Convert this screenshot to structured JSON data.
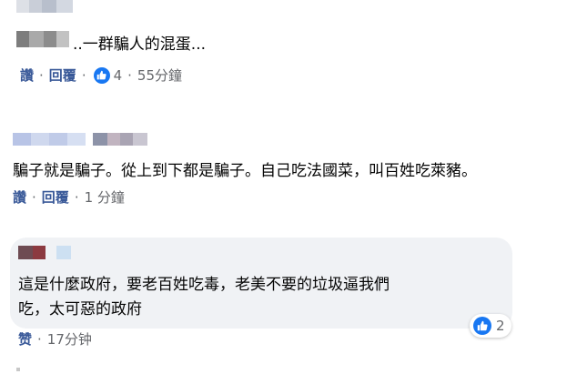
{
  "comments": [
    {
      "text": "..一群騙人的混蛋...",
      "actions": {
        "like": "讚",
        "reply": "回覆",
        "reaction_count": "4",
        "time": "55分鐘"
      }
    },
    {
      "text": "騙子就是騙子。從上到下都是騙子。自己吃法國菜，叫百姓吃萊豬。",
      "actions": {
        "like": "讚",
        "reply": "回覆",
        "time": "1 分鐘"
      }
    },
    {
      "text_line1": "這是什麼政府，要老百姓吃毒，老美不要的垃圾逼我們",
      "text_line2": "吃，太可惡的政府",
      "reaction_count": "2",
      "actions": {
        "like": "赞",
        "time": "17分钟"
      }
    }
  ],
  "separator": "·",
  "icons": {
    "reaction": "like-thumb-icon"
  },
  "colors": {
    "link": "#385898",
    "meta": "#65676b",
    "like_blue": "#1877f2",
    "bubble": "#f0f2f5"
  }
}
